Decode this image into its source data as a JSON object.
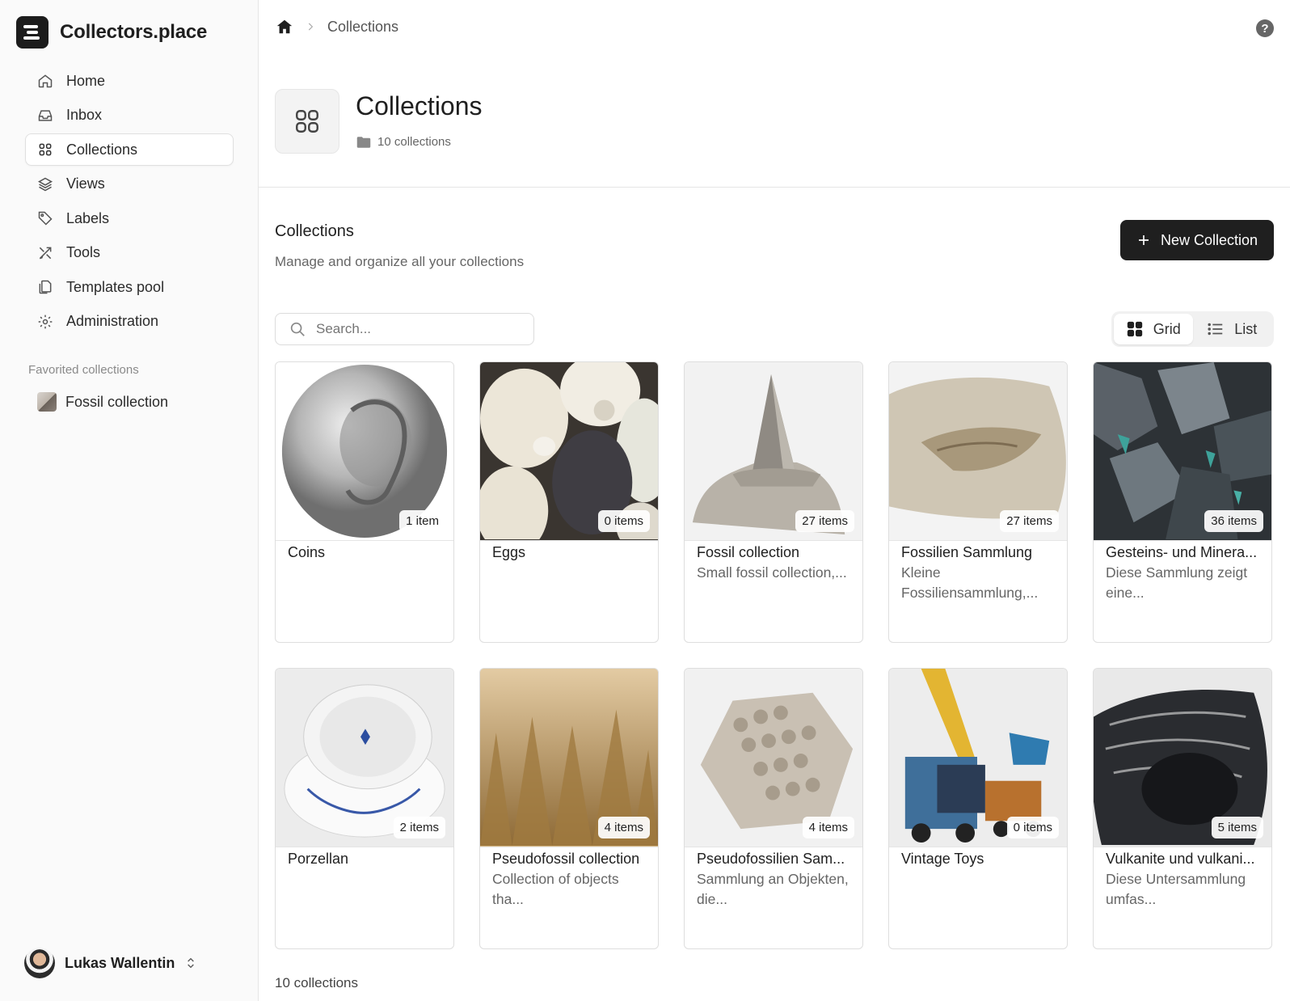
{
  "brand": {
    "name": "Collectors.place"
  },
  "sidebar": {
    "items": [
      {
        "label": "Home",
        "icon": "home-icon"
      },
      {
        "label": "Inbox",
        "icon": "inbox-icon"
      },
      {
        "label": "Collections",
        "icon": "grid-icon",
        "active": true
      },
      {
        "label": "Views",
        "icon": "layers-icon"
      },
      {
        "label": "Labels",
        "icon": "tag-icon"
      },
      {
        "label": "Tools",
        "icon": "tools-icon"
      },
      {
        "label": "Templates pool",
        "icon": "files-icon"
      },
      {
        "label": "Administration",
        "icon": "gear-icon"
      }
    ],
    "favorites_title": "Favorited collections",
    "favorites": [
      {
        "label": "Fossil collection"
      }
    ],
    "user": {
      "name": "Lukas Wallentin"
    }
  },
  "breadcrumb": {
    "current": "Collections"
  },
  "header": {
    "title": "Collections",
    "meta": "10 collections"
  },
  "section": {
    "title": "Collections",
    "subtitle": "Manage and organize all your collections",
    "new_button": "New Collection"
  },
  "search": {
    "placeholder": "Search..."
  },
  "view_toggle": {
    "grid": "Grid",
    "list": "List",
    "selected": "Grid"
  },
  "collections": [
    {
      "title": "Coins",
      "count": "1 item",
      "desc": ""
    },
    {
      "title": "Eggs",
      "count": "0 items",
      "desc": ""
    },
    {
      "title": "Fossil collection",
      "count": "27 items",
      "desc": "Small fossil collection,..."
    },
    {
      "title": "Fossilien Sammlung",
      "count": "27 items",
      "desc": "Kleine Fossiliensammlung,..."
    },
    {
      "title": "Gesteins- und Minera...",
      "count": "36 items",
      "desc": "Diese Sammlung zeigt eine..."
    },
    {
      "title": "Porzellan",
      "count": "2 items",
      "desc": ""
    },
    {
      "title": "Pseudofossil collection",
      "count": "4 items",
      "desc": "Collection of objects tha..."
    },
    {
      "title": "Pseudofossilien Sam...",
      "count": "4 items",
      "desc": "Sammlung an Objekten, die..."
    },
    {
      "title": "Vintage Toys",
      "count": "0 items",
      "desc": ""
    },
    {
      "title": "Vulkanite und vulkani...",
      "count": "5 items",
      "desc": "Diese Untersammlung umfas..."
    }
  ],
  "footer": {
    "count": "10 collections"
  }
}
